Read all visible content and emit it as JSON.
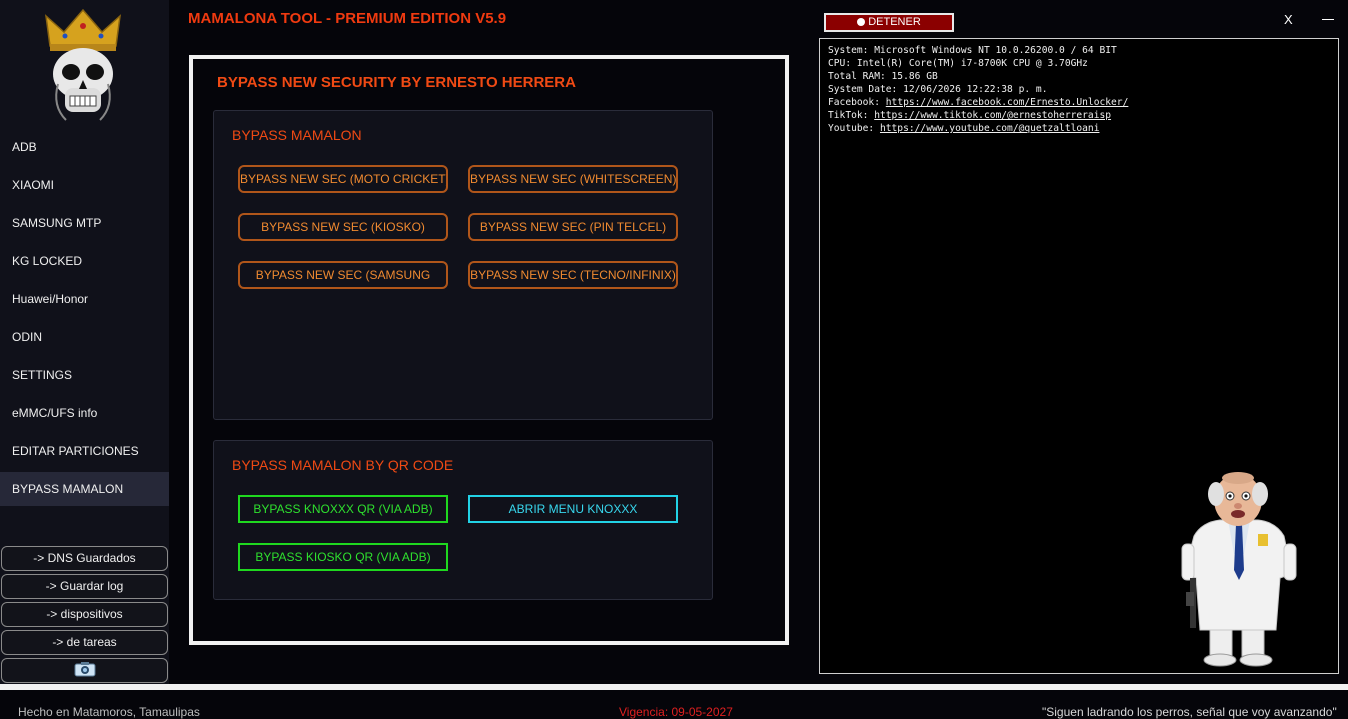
{
  "app": {
    "title": "MAMALONA TOOL - PREMIUM EDITION V5.9",
    "stop_label": "DETENER",
    "close_label": "X"
  },
  "sidebar": {
    "items": [
      {
        "label": "ADB"
      },
      {
        "label": "XIAOMI"
      },
      {
        "label": "SAMSUNG MTP"
      },
      {
        "label": "KG LOCKED"
      },
      {
        "label": "Huawei/Honor"
      },
      {
        "label": "ODIN"
      },
      {
        "label": "SETTINGS"
      },
      {
        "label": "eMMC/UFS info"
      },
      {
        "label": "EDITAR PARTICIONES"
      },
      {
        "label": "BYPASS MAMALON"
      }
    ],
    "active": "BYPASS MAMALON",
    "tools": [
      {
        "label": "-> DNS Guardados"
      },
      {
        "label": "-> Guardar log"
      },
      {
        "label": "-> dispositivos"
      },
      {
        "label": "-> de tareas"
      }
    ],
    "screenshot_icon": "camera-icon"
  },
  "panel": {
    "title": "BYPASS NEW SECURITY BY ERNESTO HERRERA",
    "group1": {
      "title": "BYPASS MAMALON",
      "buttons": [
        {
          "label": "BYPASS NEW SEC (MOTO CRICKET)"
        },
        {
          "label": "BYPASS NEW SEC (WHITESCREEN)"
        },
        {
          "label": "BYPASS NEW SEC (KIOSKO)"
        },
        {
          "label": "BYPASS NEW SEC (PIN TELCEL)"
        },
        {
          "label": "BYPASS NEW SEC (SAMSUNG"
        },
        {
          "label": "BYPASS NEW SEC (TECNO/INFINIX)"
        }
      ]
    },
    "group2": {
      "title": "BYPASS MAMALON BY QR CODE",
      "buttons": [
        {
          "label": "BYPASS KNOXXX QR (VIA ADB)"
        },
        {
          "label": "ABRIR MENU KNOXXX"
        },
        {
          "label": "BYPASS KIOSKO QR (VIA ADB)"
        }
      ]
    }
  },
  "log": {
    "system": "System: Microsoft Windows NT 10.0.26200.0 / 64 BIT",
    "cpu": "CPU: Intel(R) Core(TM) i7-8700K CPU @ 3.70GHz",
    "ram": "Total RAM: 15.86 GB",
    "date": "System Date: 12/06/2026 12:22:38 p. m.",
    "facebook_label": "Facebook: ",
    "facebook_url": "https://www.facebook.com/Ernesto.Unlocker/",
    "tiktok_label": "TikTok: ",
    "tiktok_url": "https://www.tiktok.com/@ernestoherreraisp",
    "youtube_label": "Youtube: ",
    "youtube_url": "https://www.youtube.com/@quetzaltloani"
  },
  "status": {
    "left": "Hecho en Matamoros, Tamaulipas",
    "center": "Vigencia: 09-05-2027",
    "right": "\"Siguen ladrando los perros, señal que voy avanzando\""
  },
  "colors": {
    "accent": "#f04a14",
    "orange_button": "#f08a30",
    "green_button": "#2ee02e",
    "cyan_button": "#38d8ee",
    "stop_red": "#8b0000",
    "status_red": "#e02020"
  }
}
